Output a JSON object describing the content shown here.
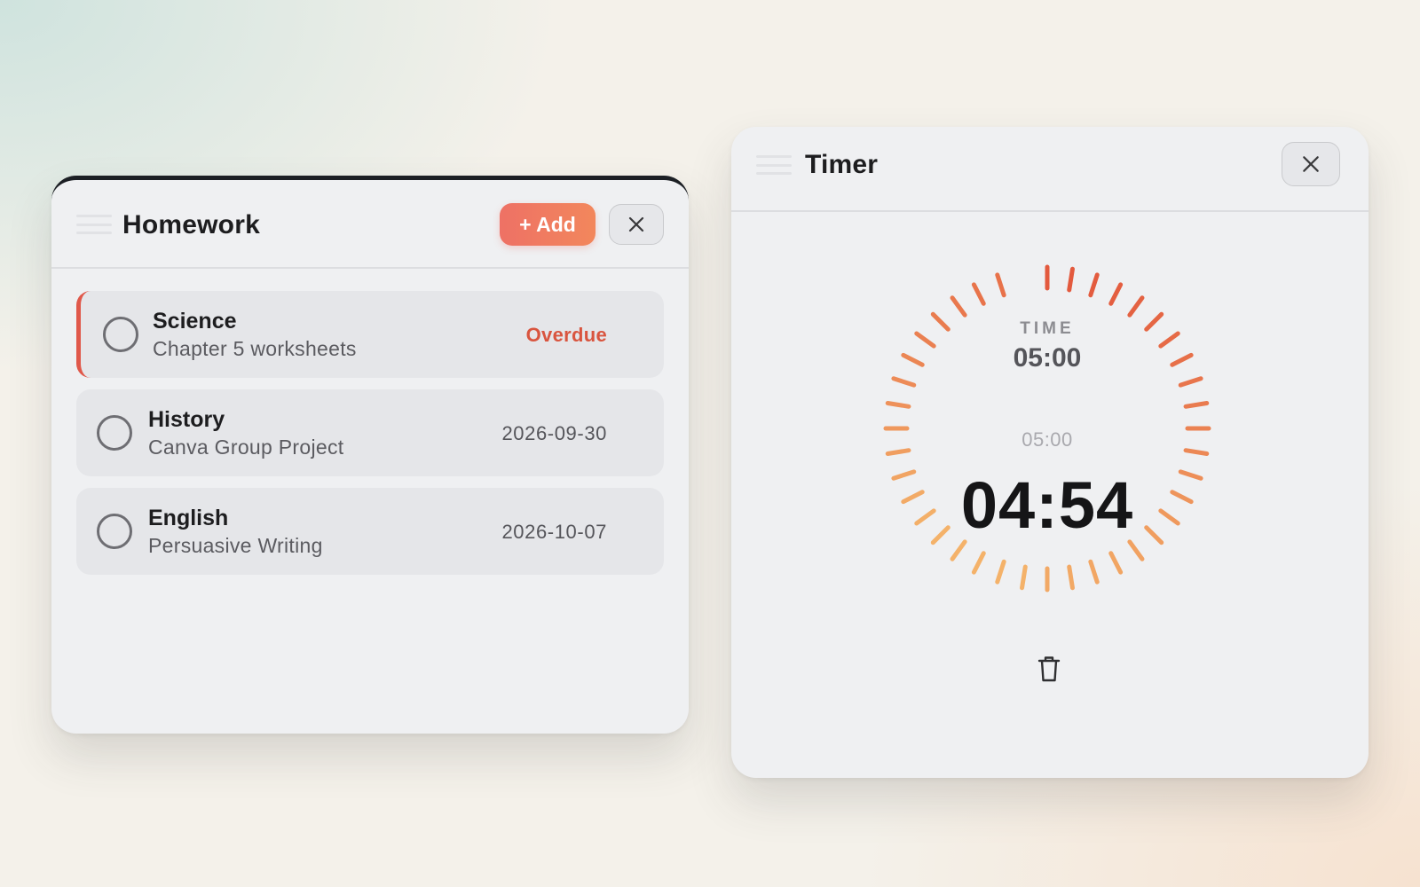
{
  "homework": {
    "title": "Homework",
    "add_label": "+ Add",
    "icons": {
      "drag": "drag-handle-icon",
      "close": "close-icon"
    },
    "tasks": [
      {
        "subject": "Science",
        "detail": "Chapter 5 worksheets",
        "due": "Overdue",
        "overdue": true
      },
      {
        "subject": "History",
        "detail": "Canva Group Project",
        "due": "2026-09-30",
        "overdue": false
      },
      {
        "subject": "English",
        "detail": "Persuasive Writing",
        "due": "2026-10-07",
        "overdue": false
      }
    ]
  },
  "timer": {
    "title": "Timer",
    "label": "TIME",
    "set_time": "05:00",
    "sub_time": "05:00",
    "remaining": "04:54",
    "remaining_fraction": 0.98,
    "icons": {
      "drag": "drag-handle-icon",
      "close": "close-icon",
      "delete": "trash-icon"
    }
  },
  "colors": {
    "accent_red": "#e0584a",
    "add_button_start": "#ee7165",
    "add_button_end": "#f2875c",
    "dial_top": "#e35a3e",
    "dial_bottom": "#f4b26a"
  }
}
